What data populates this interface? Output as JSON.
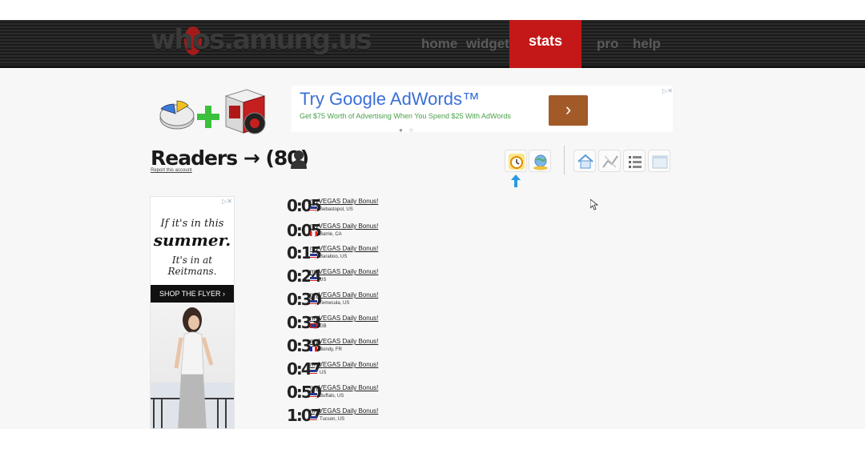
{
  "header": {
    "logo": "whos.amung.us",
    "nav": {
      "home": "home",
      "widgets": "widgets",
      "stats": "stats",
      "pro": "pro",
      "help": "help"
    }
  },
  "promo": {
    "icons": [
      "pie-chart-icon",
      "plus-icon",
      "software-box-icon"
    ]
  },
  "ad_top": {
    "title": "Try Google AdWords™",
    "subtitle": "Get $75 Worth of Advertising When You Spend $25 With AdWords",
    "button": "›",
    "close": "▷✕",
    "dots": "● ○"
  },
  "readers": {
    "heading": "Readers → (80)",
    "report_link": "Report this account"
  },
  "toolbar": {
    "icons": [
      "clock-icon",
      "map-icon",
      "home-icon",
      "chart-icon",
      "list-icon",
      "window-icon"
    ]
  },
  "ad_left": {
    "close": "▷✕",
    "line1": "If it's in this",
    "line2": "summer.",
    "line3": "It's in at Reitmans.",
    "cta": "SHOP THE FLYER ›"
  },
  "entries": [
    {
      "time": "0:05",
      "title": "myVEGAS Daily Bonus!",
      "location": "Sebastopol, US",
      "flag": "US"
    },
    {
      "time": "0:05",
      "title": "myVEGAS Daily Bonus!",
      "location": "Barrie, CA",
      "flag": "CA"
    },
    {
      "time": "0:15",
      "title": "myVEGAS Daily Bonus!",
      "location": "Baraboo, US",
      "flag": "US"
    },
    {
      "time": "0:24",
      "title": "myVEGAS Daily Bonus!",
      "location": "US",
      "flag": "US"
    },
    {
      "time": "0:30",
      "title": "myVEGAS Daily Bonus!",
      "location": "Temecula, US",
      "flag": "US"
    },
    {
      "time": "0:33",
      "title": "myVEGAS Daily Bonus!",
      "location": "GB",
      "flag": "GB"
    },
    {
      "time": "0:38",
      "title": "myVEGAS Daily Bonus!",
      "location": "Bondy, FR",
      "flag": "FR"
    },
    {
      "time": "0:47",
      "title": "myVEGAS Daily Bonus!",
      "location": "US",
      "flag": "US"
    },
    {
      "time": "0:50",
      "title": "myVEGAS Daily Bonus!",
      "location": "Buffalo, US",
      "flag": "US"
    },
    {
      "time": "1:07",
      "title": "myVEGAS Daily Bonus!",
      "location": "Tucson, US",
      "flag": "US"
    }
  ],
  "colors": {
    "accent": "#c41818",
    "link": "#3a6fd8",
    "ad_button": "#a25a28"
  }
}
